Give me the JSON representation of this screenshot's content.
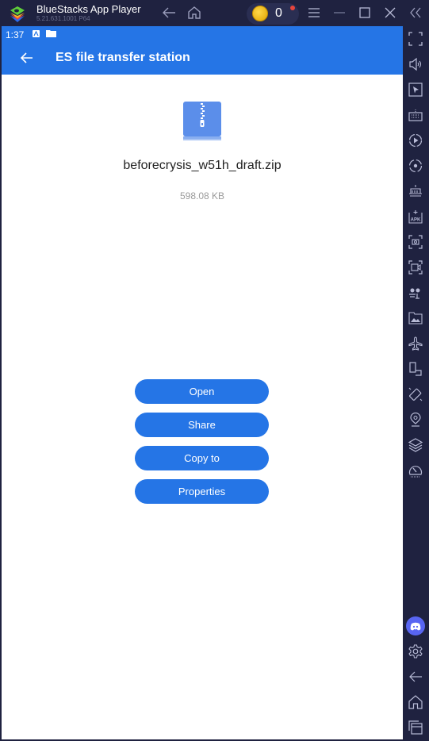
{
  "window": {
    "app_title": "BlueStacks App Player",
    "app_version": "5.21.631.1001  P64",
    "coin_count": "0",
    "icons": [
      "back-icon",
      "home-icon",
      "coin-icon",
      "menu-icon",
      "minimize-icon",
      "maximize-icon",
      "close-icon",
      "collapse-sidebar-icon"
    ]
  },
  "statusbar": {
    "time": "1:37"
  },
  "appbar": {
    "title": "ES file transfer station"
  },
  "file": {
    "name": "beforecrysis_w51h_draft.zip",
    "size": "598.08 KB"
  },
  "actions": [
    {
      "label": "Open"
    },
    {
      "label": "Share"
    },
    {
      "label": "Copy to"
    },
    {
      "label": "Properties"
    }
  ],
  "sidebar": {
    "icons": [
      "fullscreen-icon",
      "volume-icon",
      "pointer-icon",
      "keyboard-icon",
      "macro-play-icon",
      "rotate-record-icon",
      "multi-instance-icon",
      "apk-install-icon",
      "screenshot-icon",
      "screen-record-icon",
      "eco-mode-icon",
      "media-folder-icon",
      "airplane-mode-icon",
      "resize-icon",
      "shake-icon",
      "location-icon",
      "layers-icon",
      "performance-icon",
      "discord-icon",
      "settings-icon",
      "android-back-icon",
      "android-home-icon",
      "recent-apps-icon"
    ]
  }
}
